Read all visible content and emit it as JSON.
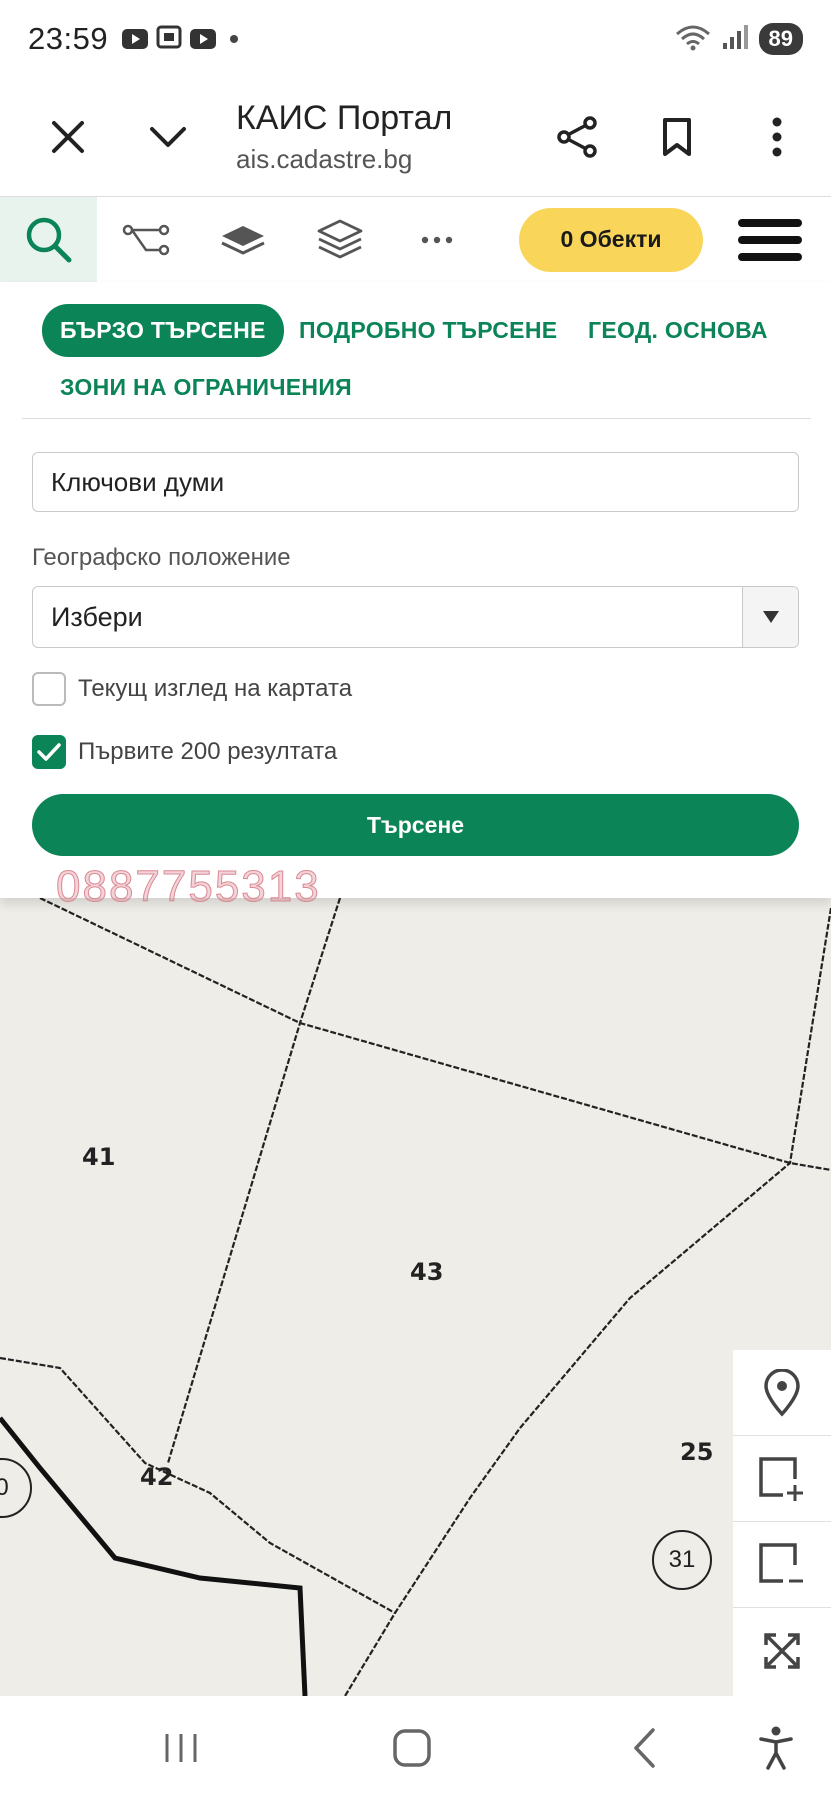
{
  "status_bar": {
    "time": "23:59",
    "battery": "89",
    "icons_left": [
      "youtube-icon",
      "screenshot-icon",
      "youtube-icon"
    ],
    "icons_right": [
      "wifi-icon",
      "signal-icon"
    ]
  },
  "browser": {
    "title": "КАИС Портал",
    "url": "ais.cadastre.bg"
  },
  "app_toolbar": {
    "tools": [
      "search-icon",
      "route-icon",
      "layer-icon",
      "layers-icon",
      "more-icon"
    ],
    "objects_button": "0 Обекти"
  },
  "search_panel": {
    "tabs": [
      "БЪРЗО ТЪРСЕНЕ",
      "ПОДРОБНО ТЪРСЕНЕ",
      "ГЕОД. ОСНОВА",
      "ЗОНИ НА ОГРАНИЧЕНИЯ"
    ],
    "keywords_placeholder": "Ключови думи",
    "geo_label": "Географско положение",
    "geo_select_value": "Избери",
    "checkbox_current_view": "Текущ изглед на картата",
    "checkbox_current_view_checked": false,
    "checkbox_first_200": "Първите 200 резултата",
    "checkbox_first_200_checked": true,
    "search_button": "Търсене",
    "watermark_phone": "0887755313"
  },
  "map": {
    "parcel_labels": [
      "41",
      "43",
      "42",
      "25",
      "0"
    ],
    "parcel_circle": "31"
  },
  "colors": {
    "accent_green": "#0b8457",
    "objects_yellow": "#f9d65a"
  }
}
